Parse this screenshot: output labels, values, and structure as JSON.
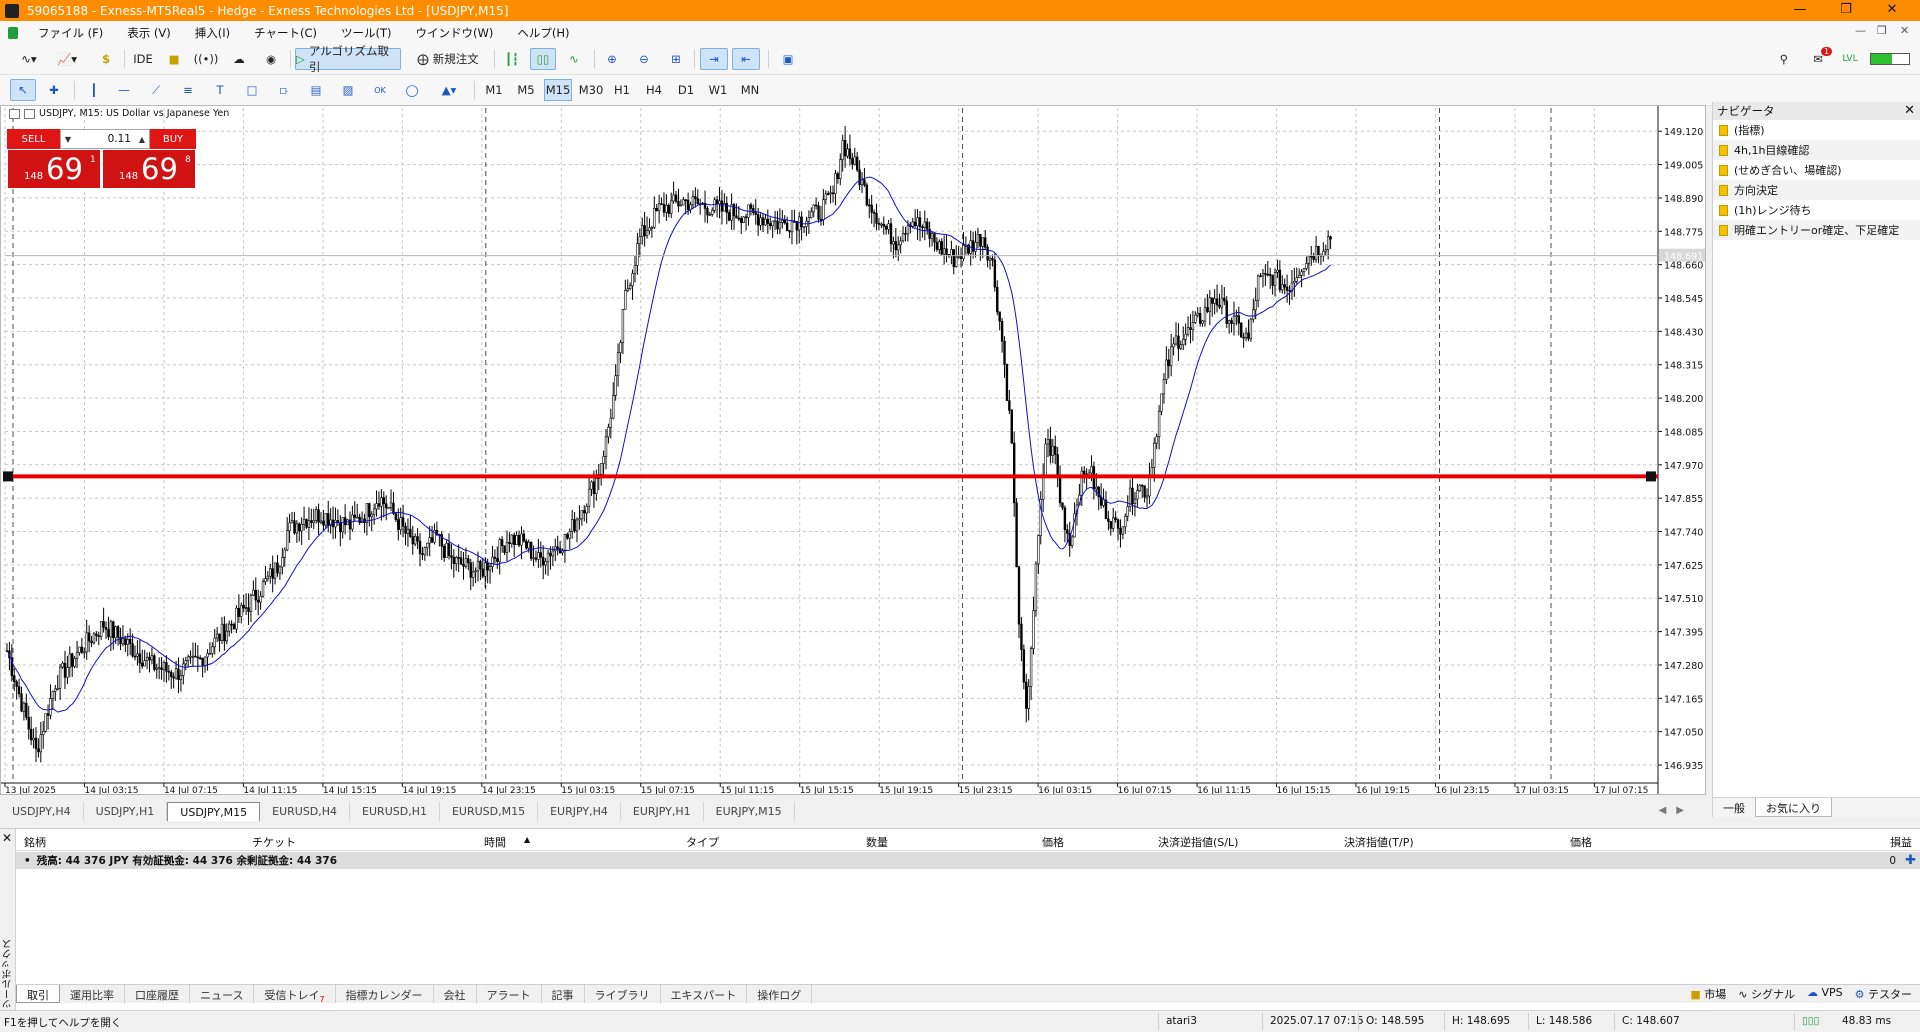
{
  "window": {
    "title": "59065188 - Exness-MT5Real5 - Hedge - Exness Technologies Ltd - [USDJPY,M15]"
  },
  "menu": [
    "ファイル (F)",
    "表示 (V)",
    "挿入(I)",
    "チャート(C)",
    "ツール(T)",
    "ウインドウ(W)",
    "ヘルプ(H)"
  ],
  "toolbar": {
    "ide": "IDE",
    "algo_trading": "アルゴリズム取引",
    "new_order": "新規注文",
    "notifications": "1"
  },
  "timeframes": [
    "M1",
    "M5",
    "M15",
    "M30",
    "H1",
    "H4",
    "D1",
    "W1",
    "MN"
  ],
  "active_timeframe": "M15",
  "chart": {
    "symbol_label": "USDJPY, M15:  US Dollar vs Japanese Yen",
    "sell_label": "SELL",
    "buy_label": "BUY",
    "lot": "0.11",
    "sell_prefix": "148",
    "sell_big": "69",
    "sell_sup": "1",
    "buy_prefix": "148",
    "buy_big": "69",
    "buy_sup": "8",
    "current_price_label": "148.691",
    "price_ticks": [
      "149.120",
      "149.005",
      "148.890",
      "148.775",
      "148.660",
      "148.545",
      "148.430",
      "148.315",
      "148.200",
      "148.085",
      "147.970",
      "147.855",
      "147.740",
      "147.625",
      "147.510",
      "147.395",
      "147.280",
      "147.165",
      "147.050",
      "146.935"
    ],
    "time_ticks": [
      "13 Jul 2025",
      "14 Jul 03:15",
      "14 Jul 07:15",
      "14 Jul 11:15",
      "14 Jul 15:15",
      "14 Jul 19:15",
      "14 Jul 23:15",
      "15 Jul 03:15",
      "15 Jul 07:15",
      "15 Jul 11:15",
      "15 Jul 15:15",
      "15 Jul 19:15",
      "15 Jul 23:15",
      "16 Jul 03:15",
      "16 Jul 07:15",
      "16 Jul 11:15",
      "16 Jul 15:15",
      "16 Jul 19:15",
      "16 Jul 23:15",
      "17 Jul 03:15",
      "17 Jul 07:15"
    ]
  },
  "chart_data": {
    "type": "candlestick",
    "symbol": "USDJPY",
    "timeframe": "M15",
    "ylim": [
      146.88,
      149.2
    ],
    "close_path": [
      [
        0,
        147.33
      ],
      [
        6,
        147.15
      ],
      [
        12,
        146.98
      ],
      [
        20,
        147.22
      ],
      [
        30,
        147.33
      ],
      [
        40,
        147.42
      ],
      [
        50,
        147.35
      ],
      [
        60,
        147.28
      ],
      [
        70,
        147.25
      ],
      [
        80,
        147.3
      ],
      [
        88,
        147.38
      ],
      [
        96,
        147.45
      ],
      [
        104,
        147.53
      ],
      [
        112,
        147.62
      ],
      [
        116,
        147.74
      ],
      [
        122,
        147.78
      ],
      [
        130,
        147.8
      ],
      [
        136,
        147.78
      ],
      [
        142,
        147.76
      ],
      [
        148,
        147.8
      ],
      [
        154,
        147.86
      ],
      [
        160,
        147.8
      ],
      [
        166,
        147.72
      ],
      [
        172,
        147.66
      ],
      [
        178,
        147.72
      ],
      [
        184,
        147.64
      ],
      [
        190,
        147.62
      ],
      [
        196,
        147.6
      ],
      [
        202,
        147.66
      ],
      [
        208,
        147.72
      ],
      [
        214,
        147.7
      ],
      [
        220,
        147.64
      ],
      [
        226,
        147.68
      ],
      [
        232,
        147.72
      ],
      [
        238,
        147.82
      ],
      [
        244,
        147.92
      ],
      [
        248,
        148.05
      ],
      [
        252,
        148.25
      ],
      [
        256,
        148.55
      ],
      [
        262,
        148.75
      ],
      [
        270,
        148.85
      ],
      [
        280,
        148.88
      ],
      [
        290,
        148.86
      ],
      [
        300,
        148.84
      ],
      [
        310,
        148.83
      ],
      [
        320,
        148.8
      ],
      [
        330,
        148.82
      ],
      [
        336,
        148.84
      ],
      [
        342,
        148.9
      ],
      [
        346,
        149.08
      ],
      [
        350,
        149.02
      ],
      [
        356,
        148.9
      ],
      [
        362,
        148.8
      ],
      [
        368,
        148.74
      ],
      [
        374,
        148.82
      ],
      [
        380,
        148.78
      ],
      [
        386,
        148.72
      ],
      [
        392,
        148.68
      ],
      [
        398,
        148.72
      ],
      [
        404,
        148.76
      ],
      [
        408,
        148.66
      ],
      [
        412,
        148.4
      ],
      [
        416,
        148.05
      ],
      [
        418,
        147.6
      ],
      [
        420,
        147.3
      ],
      [
        422,
        147.1
      ],
      [
        426,
        147.6
      ],
      [
        430,
        148.05
      ],
      [
        434,
        148.0
      ],
      [
        436,
        147.85
      ],
      [
        440,
        147.7
      ],
      [
        444,
        147.9
      ],
      [
        448,
        147.96
      ],
      [
        452,
        147.85
      ],
      [
        456,
        147.8
      ],
      [
        460,
        147.74
      ],
      [
        464,
        147.84
      ],
      [
        468,
        147.9
      ],
      [
        472,
        147.88
      ],
      [
        476,
        148.1
      ],
      [
        480,
        148.3
      ],
      [
        484,
        148.4
      ],
      [
        490,
        148.43
      ],
      [
        496,
        148.5
      ],
      [
        500,
        148.55
      ],
      [
        506,
        148.48
      ],
      [
        510,
        148.44
      ],
      [
        514,
        148.4
      ],
      [
        518,
        148.6
      ],
      [
        524,
        148.62
      ],
      [
        530,
        148.58
      ],
      [
        536,
        148.66
      ],
      [
        540,
        148.7
      ],
      [
        544,
        148.72
      ],
      [
        548,
        148.76
      ]
    ],
    "sma": {
      "periods": 549,
      "note": "blue moving average line"
    },
    "horizontal_line": {
      "price": 147.93,
      "color": "#e80000"
    }
  },
  "navigator": {
    "title": "ナビゲータ",
    "items": [
      "(指標)",
      "4h,1h目線確認",
      "(せめぎ合い、場確認)",
      "方向決定",
      "(1h)レンジ待ち",
      "明確エントリーor確定、下足確定"
    ],
    "tabs": [
      "一般",
      "お気に入り"
    ]
  },
  "chart_tabs": [
    "USDJPY,H4",
    "USDJPY,H1",
    "USDJPY,M15",
    "EURUSD,H4",
    "EURUSD,H1",
    "EURUSD,M15",
    "EURJPY,H4",
    "EURJPY,H1",
    "EURJPY,M15"
  ],
  "toolbox": {
    "side_label": "ツールボックス",
    "headers": {
      "symbol": "銘柄",
      "ticket": "チケット",
      "time": "時間",
      "type": "タイプ",
      "volume": "数量",
      "price": "価格",
      "sl": "決済逆指値(S/L)",
      "tp": "決済指値(T/P)",
      "price2": "価格",
      "profit": "損益"
    },
    "balance_row": "残高: 44 376 JPY  有効証拠金: 44 376  余剰証拠金: 44 376",
    "balance_profit": "0",
    "tabs": [
      "取引",
      "運用比率",
      "口座履歴",
      "ニュース",
      "受信トレイ",
      "指標カレンダー",
      "会社",
      "アラート",
      "記事",
      "ライブラリ",
      "エキスパート",
      "操作ログ"
    ],
    "inbox_count": "7",
    "right_tabs": [
      "市場",
      "シグナル",
      "VPS",
      "テスター"
    ]
  },
  "status": {
    "help": "F1を押してヘルプを開く",
    "profile": "atari3",
    "datetime": "2025.07.17 07:15",
    "open": "O: 148.595",
    "high": "H: 148.695",
    "low": "L: 148.586",
    "close": "C: 148.607",
    "ping": "48.83 ms"
  }
}
